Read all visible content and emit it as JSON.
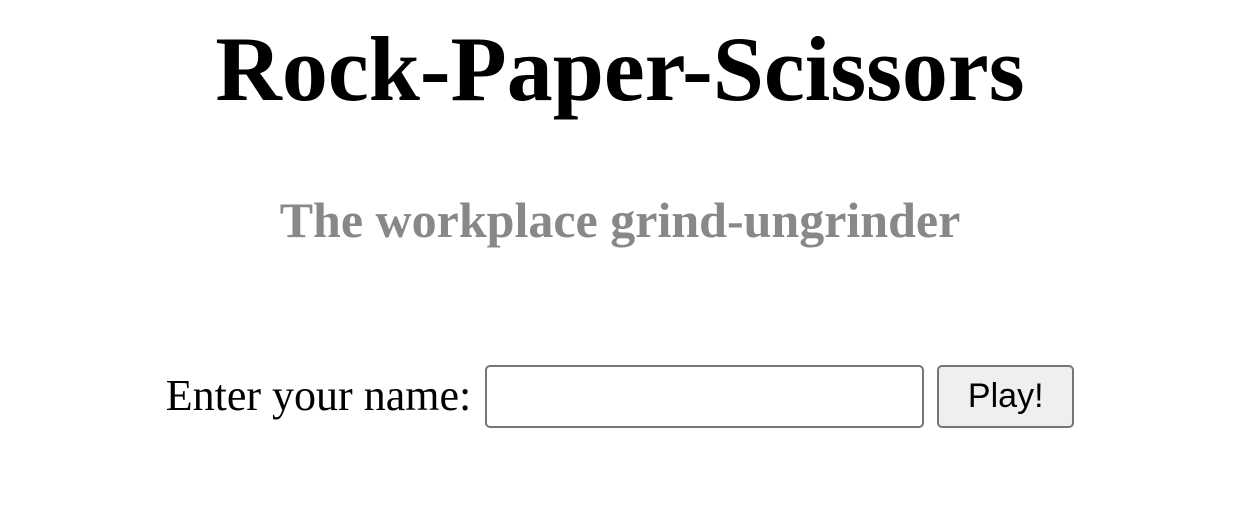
{
  "header": {
    "title": "Rock-Paper-Scissors",
    "subtitle": "The workplace grind-ungrinder"
  },
  "form": {
    "name_label": "Enter your name:",
    "name_value": "",
    "name_placeholder": "",
    "play_label": "Play!"
  },
  "colors": {
    "title": "#000000",
    "subtitle": "#888888",
    "button_background": "#efefef",
    "border": "#767676"
  }
}
